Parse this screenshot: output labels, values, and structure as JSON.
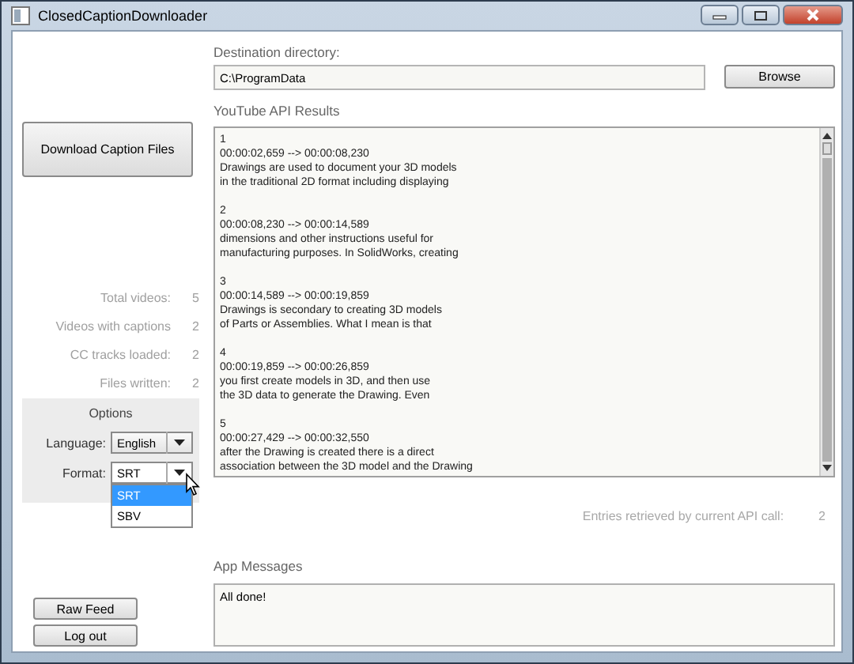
{
  "window": {
    "title": "ClosedCaptionDownloader"
  },
  "download_button": "Download Caption Files",
  "stats": [
    {
      "label": "Total videos:",
      "value": "5"
    },
    {
      "label": "Videos with captions",
      "value": "2"
    },
    {
      "label": "CC tracks loaded:",
      "value": "2"
    },
    {
      "label": "Files written:",
      "value": "2"
    }
  ],
  "options": {
    "title": "Options",
    "language": {
      "label": "Language:",
      "value": "English"
    },
    "format": {
      "label": "Format:",
      "value": "SRT",
      "expanded": true,
      "options": [
        {
          "label": "SRT",
          "selected": true
        },
        {
          "label": "SBV",
          "selected": false
        }
      ]
    }
  },
  "buttons": [
    "Raw Feed",
    "Log out"
  ],
  "destination": {
    "label": "Destination directory:",
    "value": "C:\\ProgramData",
    "browse": "Browse"
  },
  "results": {
    "label": "YouTube API Results",
    "entries": [
      {
        "number": "1",
        "time": "00:00:02,659 --> 00:00:08,230",
        "lines": [
          "Drawings are used to document your 3D models",
          "in the traditional 2D format including displaying"
        ]
      },
      {
        "number": "2",
        "time": "00:00:08,230 --> 00:00:14,589",
        "lines": [
          "dimensions and other instructions useful for",
          "manufacturing purposes. In SolidWorks, creating"
        ]
      },
      {
        "number": "3",
        "time": "00:00:14,589 --> 00:00:19,859",
        "lines": [
          "Drawings is secondary to creating 3D models",
          "of Parts or Assemblies. What I mean is that"
        ]
      },
      {
        "number": "4",
        "time": "00:00:19,859 --> 00:00:26,859",
        "lines": [
          "you first create models in 3D, and then use",
          "the 3D data to generate the Drawing. Even"
        ]
      },
      {
        "number": "5",
        "time": "00:00:27,429 --> 00:00:32,550",
        "lines": [
          "after the Drawing is created there is a direct",
          "association between the 3D model and the Drawing"
        ]
      }
    ]
  },
  "entries": {
    "label": "Entries retrieved by current API call:",
    "value": "2"
  },
  "messages": {
    "label": "App Messages",
    "text": "All done!"
  }
}
